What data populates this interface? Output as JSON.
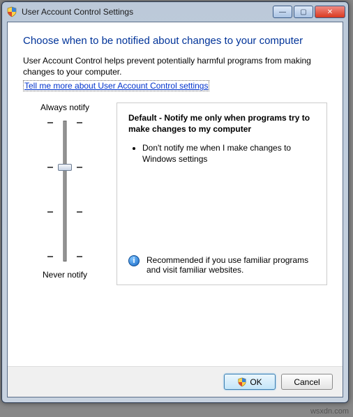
{
  "window": {
    "title": "User Account Control Settings",
    "icon": "uac-shield-icon"
  },
  "heading": "Choose when to be notified about changes to your computer",
  "description": "User Account Control helps prevent potentially harmful programs from making changes to your computer.",
  "link_text": "Tell me more about User Account Control settings",
  "slider": {
    "top_label": "Always notify",
    "bottom_label": "Never notify",
    "levels": 4,
    "current_level": 2
  },
  "info": {
    "title": "Default - Notify me only when programs try to make changes to my computer",
    "bullets": [
      "Don't notify me when I make changes to Windows settings"
    ],
    "recommendation": "Recommended if you use familiar programs and visit familiar websites."
  },
  "buttons": {
    "ok": "OK",
    "cancel": "Cancel"
  },
  "watermark": "wsxdn.com"
}
